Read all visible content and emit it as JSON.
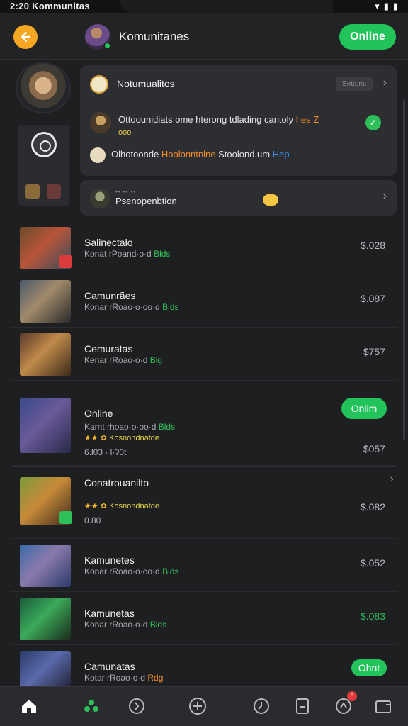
{
  "status_bar": {
    "time": "2:20",
    "carrier": "Kommunitas"
  },
  "header": {
    "title": "Komunitanes",
    "online_label": "Online"
  },
  "notification_card": {
    "title": "Notumualitos",
    "chip": "Settons",
    "row1_text": "Ottoounidiats ome hterong tdlading cantoly",
    "row1_accent": "hes Z",
    "row1_sub": "ooo",
    "row2_text": "Olhotoonde",
    "row2_accent": "Hoolonntnlne",
    "row2_text2": "Stoolond.um",
    "row2_blue": "Hep"
  },
  "mini_card": {
    "label": "Psenopenbtion",
    "tiny": "•• •• ••"
  },
  "list": [
    {
      "name": "Salinectalo",
      "sub": "Konat rPoand·o·d",
      "sub_tag": "Blds",
      "price": "$.028"
    },
    {
      "name": "Camunrães",
      "sub": "Konar rRoao·o·oo·d",
      "sub_tag": "Blds",
      "price": "$.087"
    },
    {
      "name": "Cemuratas",
      "sub": "Kenar rRoao·o·d",
      "sub_tag": "Blg",
      "price": "$757"
    },
    {
      "name": "Online",
      "sub": "Karnt rhoao·o·oo·d",
      "sub_tag": "Blds",
      "pill": "Onlim",
      "stars": "★★ ✿",
      "stars_text": "Kosnohdnatde",
      "meta": "6.l03      ·  l·ʔ0t",
      "price": "$057"
    },
    {
      "name": "Conatrouanilto",
      "stars": "★★ ✿",
      "stars_text": "Kosnondnatde",
      "meta": "0.80",
      "price": "$.082"
    },
    {
      "name": "Kamunetes",
      "sub": "Konar rRoao·o·oo·d",
      "sub_tag": "Blds",
      "price": "$.052"
    },
    {
      "name": "Kamunetas",
      "sub": "Konar rRoao·o·d",
      "sub_tag": "Blds",
      "price": "$.083"
    },
    {
      "name": "Camunatas",
      "sub": "Kotar rRoao·o·d",
      "sub_tag": "Rdg",
      "pill": "Ohnt",
      "price": ""
    }
  ],
  "tabbar": {
    "badge_count": "8"
  },
  "colors": {
    "accent_green": "#22c35b",
    "accent_orange": "#f5a623",
    "background": "#1e1f21"
  }
}
